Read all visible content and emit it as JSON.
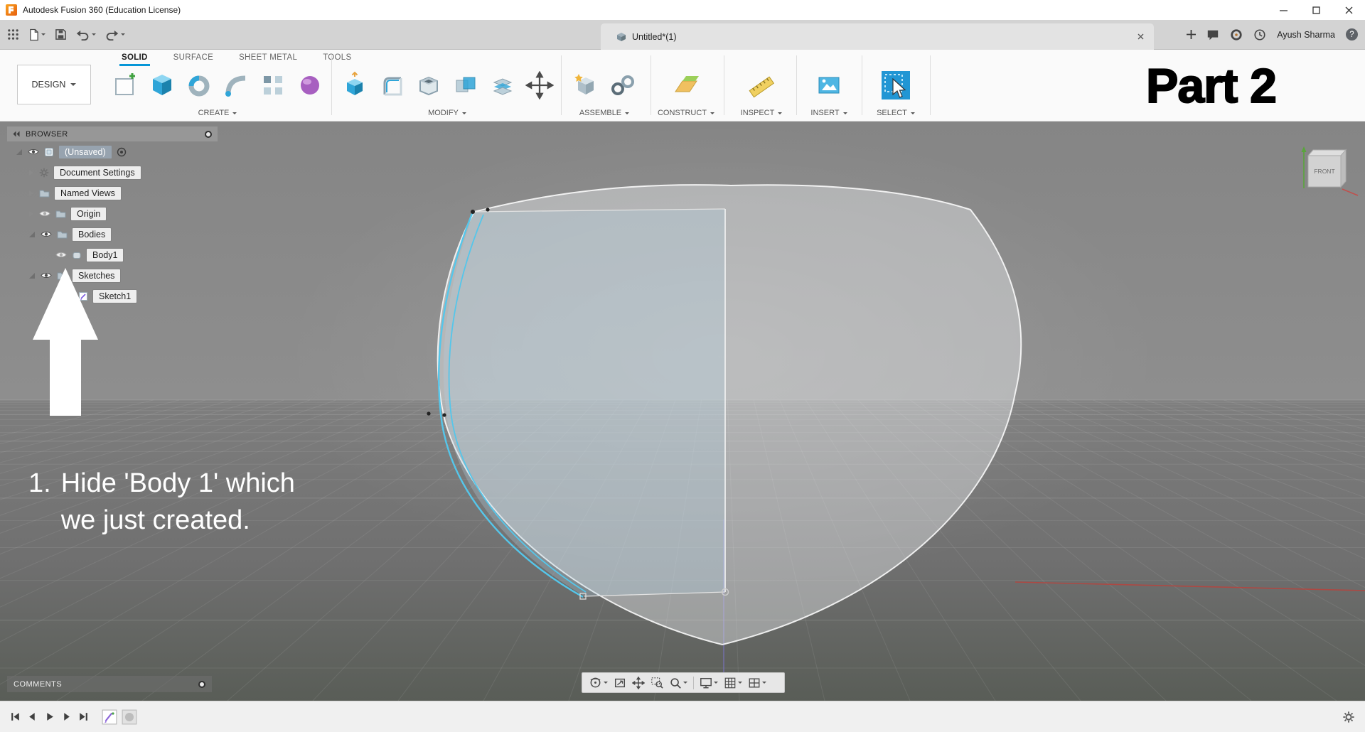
{
  "colors": {
    "accent_blue": "#0696d7",
    "select_tool_blue": "#2196d4",
    "sketch_highlight_cyan": "#55c6ea",
    "axis_red": "#c0504d",
    "annotation_white": "#ffffff",
    "part_label_black": "#000000"
  },
  "title_bar": {
    "app_title": "Autodesk Fusion 360 (Education License)"
  },
  "quick_bar": {
    "document_tab_label": "Untitled*(1)",
    "user_name": "Ayush Sharma",
    "help_glyph": "?"
  },
  "ribbon": {
    "design_menu_label": "DESIGN",
    "tabs": [
      {
        "label": "SOLID",
        "active": true
      },
      {
        "label": "SURFACE",
        "active": false
      },
      {
        "label": "SHEET METAL",
        "active": false
      },
      {
        "label": "TOOLS",
        "active": false
      }
    ],
    "groups": [
      {
        "label": "CREATE"
      },
      {
        "label": "MODIFY"
      },
      {
        "label": "ASSEMBLE"
      },
      {
        "label": "CONSTRUCT"
      },
      {
        "label": "INSPECT"
      },
      {
        "label": "INSERT"
      },
      {
        "label": "SELECT"
      }
    ]
  },
  "browser": {
    "header_label": "BROWSER",
    "items": [
      {
        "label": "(Unsaved)",
        "selected": true
      },
      {
        "label": "Document Settings"
      },
      {
        "label": "Named Views"
      },
      {
        "label": "Origin"
      },
      {
        "label": "Bodies"
      },
      {
        "label": "Body1"
      },
      {
        "label": "Sketches"
      },
      {
        "label": "Sketch1"
      }
    ]
  },
  "viewcube": {
    "face_label": "FRONT"
  },
  "comments_bar": {
    "label": "COMMENTS"
  },
  "annotations": {
    "part_label": "Part 2",
    "step_number": "1.",
    "step_line1": "Hide 'Body 1' which",
    "step_line2": "we just created."
  }
}
